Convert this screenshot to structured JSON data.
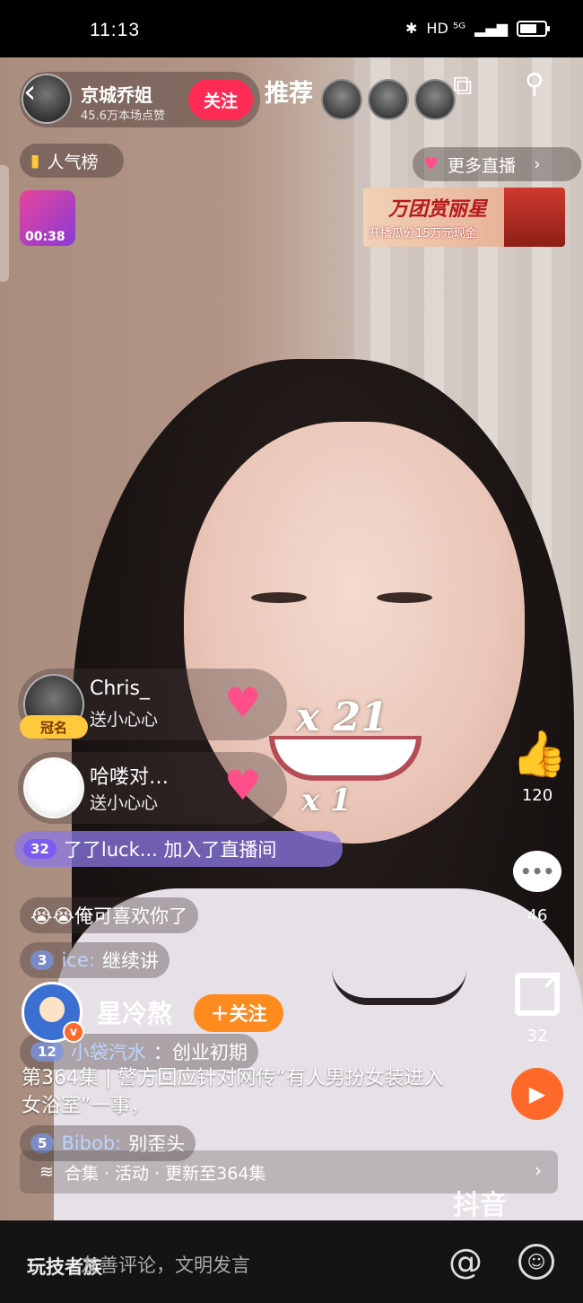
{
  "status_bar": {
    "time": "11:13",
    "network": "HD ⁵ᴳ"
  },
  "live_header": {
    "host_name": "京城乔姐",
    "host_sub": "45.6万本场点赞",
    "follow_label": "关注",
    "tab_title": "推荐",
    "ranking_label": "人气榜",
    "more_live_label": "更多直播",
    "gift_timer": "00:38",
    "banner_title": "万团赏丽星",
    "banner_sub": "开播瓜分15万元现金"
  },
  "gift_feed": [
    {
      "user": "Chris_",
      "action": "送小心心",
      "badge": "冠名",
      "count": "x 21"
    },
    {
      "user": "哈喽对…",
      "action": "送小心心",
      "count": "x 1"
    }
  ],
  "join_notice": {
    "level": "32",
    "text": "了了luck... 加入了直播间"
  },
  "chat": [
    {
      "text": "😭😭俺可喜欢你了"
    },
    {
      "level": "3",
      "user": "ice:",
      "text": "继续讲"
    },
    {
      "level": "12",
      "user": "小袋汽水",
      "text": "：创业初期"
    },
    {
      "level": "5",
      "user": "Bibob:",
      "text": "别歪头"
    }
  ],
  "video_info": {
    "author": "星冷熬",
    "follow_label": "＋关注",
    "description": "第364集 | 警方回应针对网传“有人男扮女装进入女浴室”一事，",
    "collection": "合集 · 活动 · 更新至364集"
  },
  "actions": {
    "likes": "120",
    "comments": "46",
    "shares": "32"
  },
  "watermark": "抖音",
  "bottom": {
    "watermark_left": "玩技者族",
    "placeholder": "友善评论，文明发言"
  },
  "colors": {
    "follow_red": "#fe2c55",
    "follow_orange": "#ff8a1e",
    "join_purple": "#8c78e6"
  }
}
